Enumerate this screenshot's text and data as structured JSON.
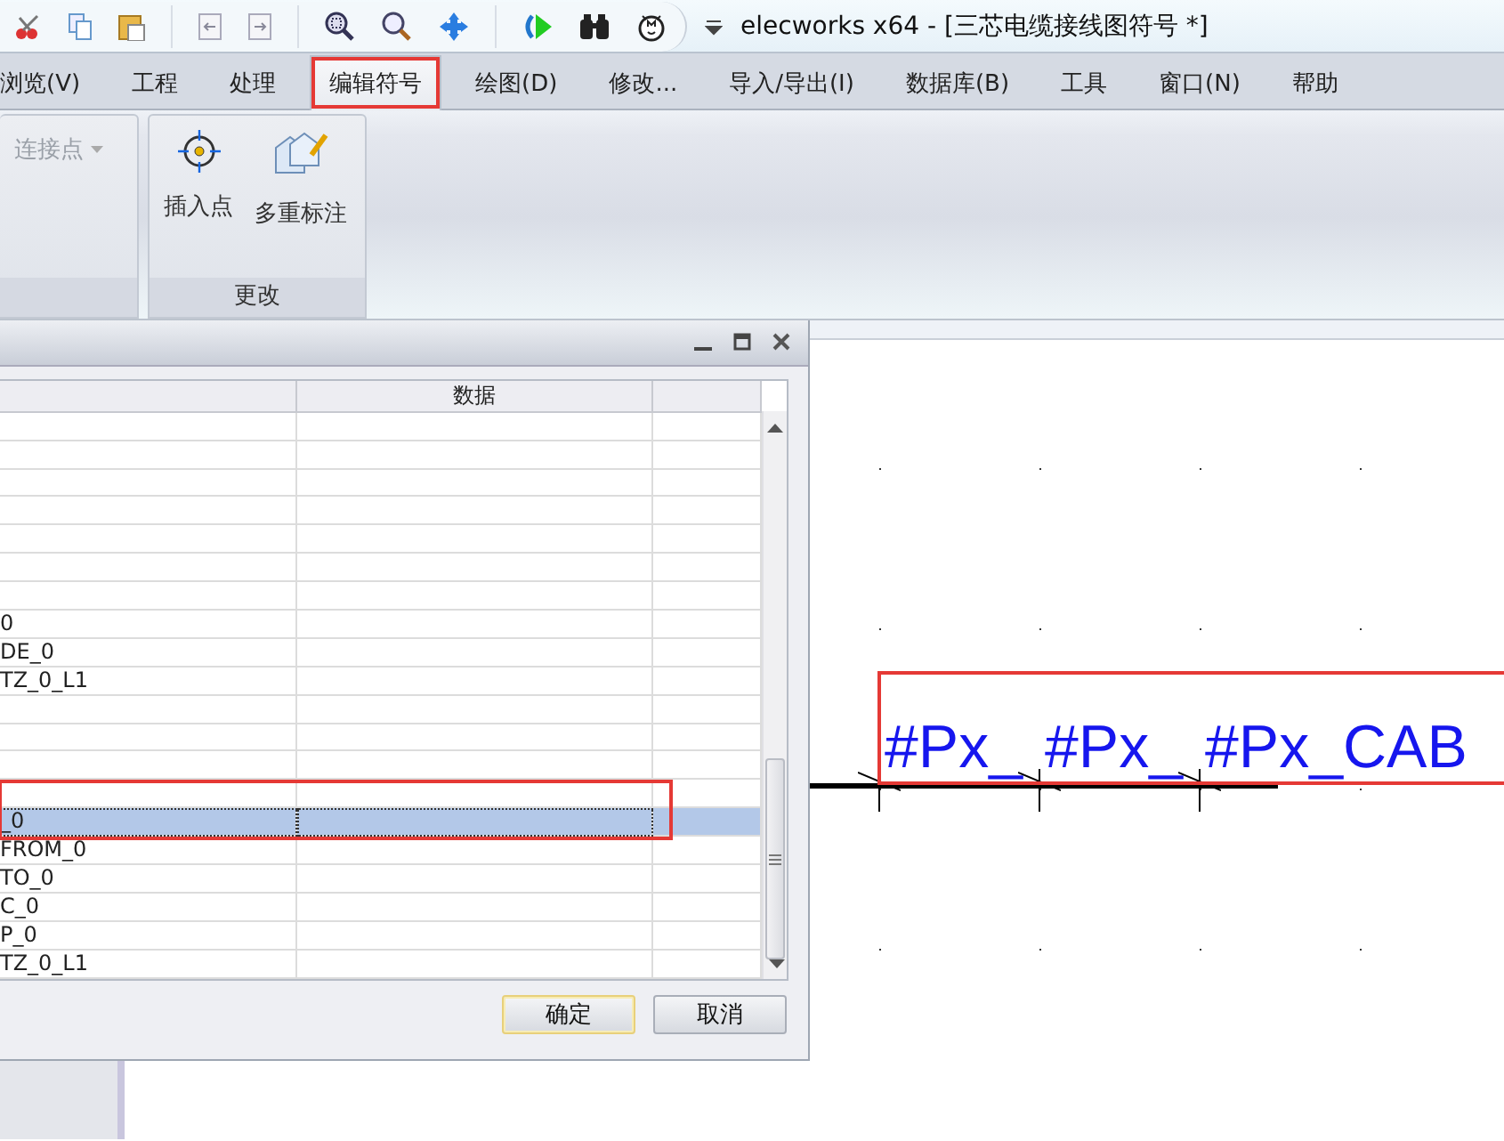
{
  "window": {
    "title": "elecworks x64 - [三芯电缆接线图符号 *]"
  },
  "menu": [
    {
      "label": "浏览(V)",
      "selected": false
    },
    {
      "label": "工程",
      "selected": false
    },
    {
      "label": "处理",
      "selected": false
    },
    {
      "label": "编辑符号",
      "selected": true
    },
    {
      "label": "绘图(D)",
      "selected": false
    },
    {
      "label": "修改...",
      "selected": false
    },
    {
      "label": "导入/导出(I)",
      "selected": false
    },
    {
      "label": "数据库(B)",
      "selected": false
    },
    {
      "label": "工具",
      "selected": false
    },
    {
      "label": "窗口(N)",
      "selected": false
    },
    {
      "label": "帮助",
      "selected": false
    }
  ],
  "ribbon": {
    "groups": [
      {
        "items": [
          {
            "label": "连接点",
            "kind": "dropdown",
            "disabled": true
          }
        ]
      },
      {
        "label": "更改",
        "items": [
          {
            "label": "插入点",
            "kind": "insert-point",
            "disabled": false
          },
          {
            "label": "多重标注",
            "kind": "multi-tag",
            "disabled": false
          }
        ]
      }
    ]
  },
  "dialog": {
    "column_2_header": "数据",
    "rows": [
      {
        "selected": false
      },
      {
        "selected": false
      },
      {
        "selected": false
      },
      {
        "selected": false
      },
      {
        "selected": false
      },
      {
        "selected": false
      },
      {
        "selected": false
      },
      {
        "column_1": "0",
        "selected": false
      },
      {
        "column_1": "DE_0",
        "selected": false
      },
      {
        "column_1": "TZ_0_L1",
        "selected": false
      },
      {
        "selected": false
      },
      {
        "selected": false
      },
      {
        "selected": false
      },
      {
        "selected": false
      },
      {
        "column_1": "_0",
        "selected": true
      },
      {
        "column_1": "FROM_0",
        "selected": false
      },
      {
        "column_1": "TO_0",
        "selected": false
      },
      {
        "column_1": "C_0",
        "selected": false
      },
      {
        "column_1": "P_0",
        "selected": false
      },
      {
        "column_1": "TZ_0_L1",
        "selected": false
      }
    ],
    "buttons": [
      {
        "label": "确定",
        "default": true
      },
      {
        "label": "取消",
        "default": false
      }
    ]
  },
  "canvas": {
    "labels": [
      "#Px_",
      "#Px_",
      "#Px_CAB"
    ]
  }
}
